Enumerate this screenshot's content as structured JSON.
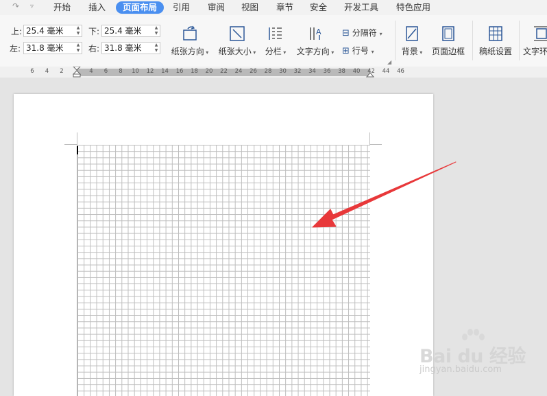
{
  "quick_access": {
    "redo_icon": "redo-icon",
    "dropdown_icon": "chevron-down-icon"
  },
  "menu": {
    "tabs": [
      "开始",
      "插入",
      "页面布局",
      "引用",
      "审阅",
      "视图",
      "章节",
      "安全",
      "开发工具",
      "特色应用"
    ],
    "active_tab": "页面布局"
  },
  "ribbon": {
    "margins": {
      "top_label": "上:",
      "top_value": "25.4 毫米",
      "bottom_label": "下:",
      "bottom_value": "25.4 毫米",
      "left_label": "左:",
      "left_value": "31.8 毫米",
      "right_label": "右:",
      "right_value": "31.8 毫米"
    },
    "buttons": {
      "orientation": "纸张方向",
      "size": "纸张大小",
      "columns": "分栏",
      "text_direction": "文字方向",
      "breaks": "分隔符",
      "line_numbers": "行号",
      "background": "背景",
      "page_border": "页面边框",
      "manuscript": "稿纸设置",
      "text_wrap": "文字环"
    }
  },
  "ruler": {
    "numbers": [
      "6",
      "4",
      "2",
      "2",
      "4",
      "6",
      "8",
      "10",
      "12",
      "14",
      "16",
      "18",
      "20",
      "22",
      "24",
      "26",
      "28",
      "30",
      "32",
      "34",
      "36",
      "38",
      "40",
      "42",
      "44",
      "46"
    ]
  },
  "watermark": {
    "brand": "Bai du 经验",
    "url": "jingyan.baidu.com"
  },
  "colors": {
    "accent": "#4a8ff0",
    "arrow": "#e8383a",
    "grid": "#bdbdbd"
  }
}
